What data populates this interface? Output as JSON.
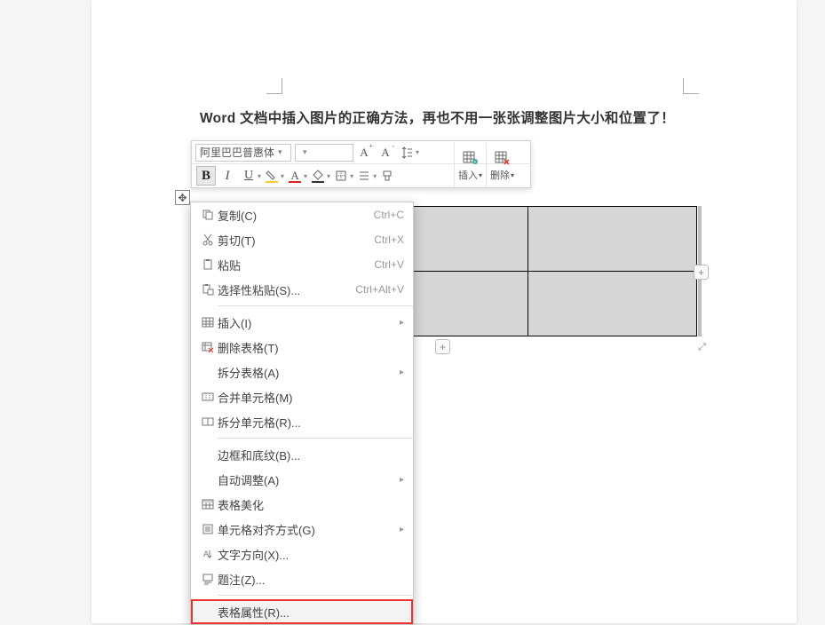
{
  "document": {
    "heading": "Word 文档中插入图片的正确方法，再也不用一张张调整图片大小和位置了！"
  },
  "toolbar": {
    "font_name": "阿里巴巴普惠体",
    "font_size": "",
    "bold": "B",
    "italic": "I",
    "underline": "U",
    "increase_font": "A",
    "decrease_font": "A",
    "insert_label": "插入",
    "delete_label": "删除"
  },
  "context_menu": {
    "copy": {
      "label": "复制(C)",
      "shortcut": "Ctrl+C"
    },
    "cut": {
      "label": "剪切(T)",
      "shortcut": "Ctrl+X"
    },
    "paste": {
      "label": "粘贴",
      "shortcut": "Ctrl+V"
    },
    "paste_special": {
      "label": "选择性粘贴(S)...",
      "shortcut": "Ctrl+Alt+V"
    },
    "insert": {
      "label": "插入(I)"
    },
    "delete_table": {
      "label": "删除表格(T)"
    },
    "split_table": {
      "label": "拆分表格(A)"
    },
    "merge_cells": {
      "label": "合并单元格(M)"
    },
    "split_cells": {
      "label": "拆分单元格(R)..."
    },
    "borders_shading": {
      "label": "边框和底纹(B)..."
    },
    "autofit": {
      "label": "自动调整(A)"
    },
    "table_beautify": {
      "label": "表格美化"
    },
    "cell_align": {
      "label": "单元格对齐方式(G)"
    },
    "text_direction": {
      "label": "文字方向(X)..."
    },
    "caption": {
      "label": "题注(Z)..."
    },
    "table_properties": {
      "label": "表格属性(R)..."
    }
  },
  "icons": {
    "plus": "+",
    "arrow_right": "▸",
    "dropdown": "▾",
    "move": "✥",
    "resize": "⤢"
  }
}
